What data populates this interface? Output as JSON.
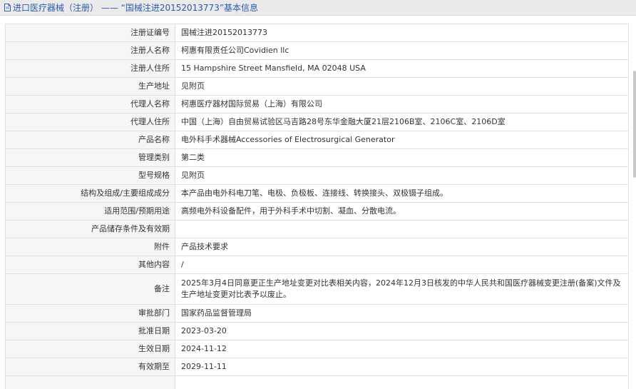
{
  "header": {
    "title": "进口医疗器械（注册） —— “国械注进20152013773”基本信息"
  },
  "rows": [
    {
      "label": "注册证编号",
      "value": "国械注进20152013773"
    },
    {
      "label": "注册人名称",
      "value": "柯惠有限责任公司Covidien llc"
    },
    {
      "label": "注册人住所",
      "value": "15 Hampshire Street Mansfield, MA 02048 USA"
    },
    {
      "label": "生产地址",
      "value": "见附页"
    },
    {
      "label": "代理人名称",
      "value": "柯惠医疗器材国际贸易（上海）有限公司"
    },
    {
      "label": "代理人住所",
      "value": "中国（上海）自由贸易试验区马吉路28号东华金融大厦21层2106B室、2106C室、2106D室"
    },
    {
      "label": "产品名称",
      "value": "电外科手术器械Accessories of Electrosurgical Generator"
    },
    {
      "label": "管理类别",
      "value": "第二类"
    },
    {
      "label": "型号规格",
      "value": "见附页"
    },
    {
      "label": "结构及组成/主要组成成分",
      "value": "本产品由电外科电刀笔、电极、负极板、连接线、转换接头、双极镊子组成。"
    },
    {
      "label": "适用范围/预期用途",
      "value": "高频电外科设备配件，用于外科手术中切割、凝血、分散电流。"
    },
    {
      "label": "产品储存条件及有效期",
      "value": ""
    },
    {
      "label": "附件",
      "value": "产品技术要求"
    },
    {
      "label": "其他内容",
      "value": "/"
    },
    {
      "label": "备注",
      "value": "2025年3月4日同意更正生产地址变更对比表相关内容，2024年12月3日核发的中华人民共和国医疗器械变更注册(备案)文件及生产地址变更对比表予以废止。"
    },
    {
      "label": "审批部门",
      "value": "国家药品监督管理局"
    },
    {
      "label": "批准日期",
      "value": "2023-03-20"
    },
    {
      "label": "生效日期",
      "value": "2024-11-12"
    },
    {
      "label": "有效期至",
      "value": "2029-11-11"
    },
    {
      "label": "",
      "value": ""
    }
  ]
}
